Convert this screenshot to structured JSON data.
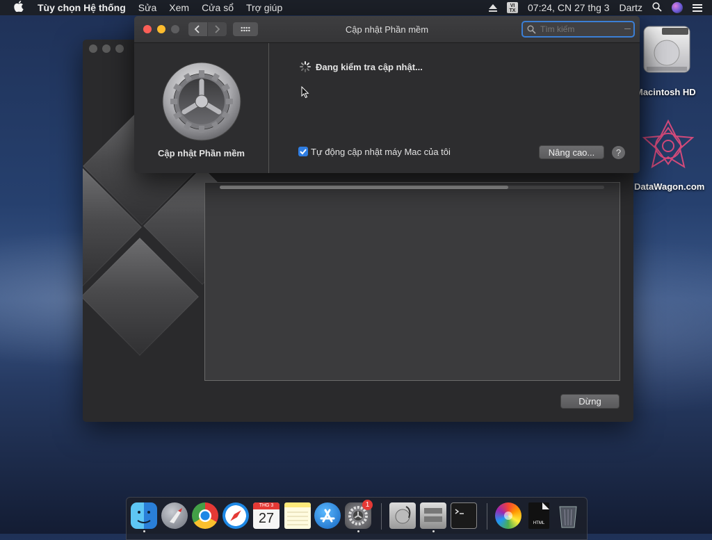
{
  "menubar": {
    "app_name": "Tùy chọn Hệ thống",
    "items": [
      "Sửa",
      "Xem",
      "Cửa sổ",
      "Trợ giúp"
    ],
    "input_source": "VI TX",
    "clock": "07:24, CN 27 thg 3",
    "user": "Dartz"
  },
  "back_window": {
    "stop_button": "Dừng",
    "progress_fraction": 0.75
  },
  "front_window": {
    "title": "Cập nhật Phần mềm",
    "search_placeholder": "Tìm kiếm",
    "pane_label": "Cập nhật Phần mềm",
    "status": "Đang kiểm tra cập nhật...",
    "auto_update_label": "Tự động cập nhật máy Mac của tôi",
    "auto_update_checked": true,
    "advanced_button": "Nâng cao...",
    "help_button": "?"
  },
  "desktop": {
    "icons": [
      {
        "label": "Macintosh HD",
        "icon": "hard-drive-icon"
      },
      {
        "label": "DataWagon.com",
        "icon": "datawagon-icon"
      }
    ]
  },
  "dock": {
    "calendar_month": "THG 3",
    "calendar_day": "27",
    "settings_badge": "1",
    "items": [
      "finder-icon",
      "launchpad-icon",
      "chrome-icon",
      "safari-icon",
      "calendar-icon",
      "notes-icon",
      "app-store-icon",
      "system-preferences-icon",
      "disk-utility-icon",
      "boot-camp-icon",
      "terminal-icon",
      "photos-icon",
      "html-file-icon",
      "trash-icon"
    ]
  },
  "colors": {
    "accent": "#2f7de1",
    "close": "#fc5f57",
    "minimize": "#fdbc2e",
    "badge": "#e53935"
  }
}
